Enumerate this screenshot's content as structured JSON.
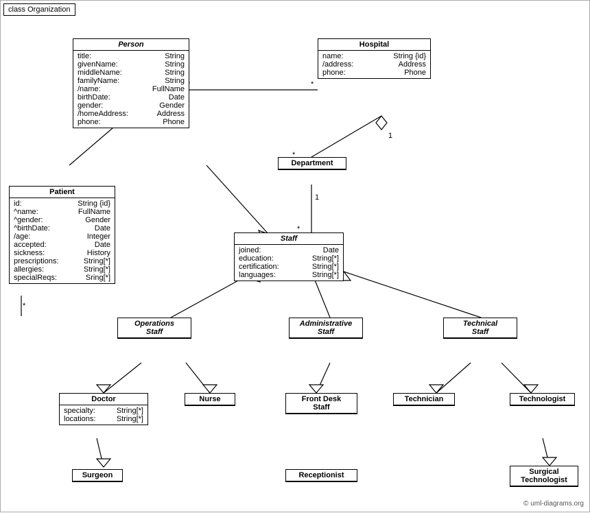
{
  "diagram": {
    "title": "class Organization",
    "copyright": "© uml-diagrams.org",
    "classes": {
      "person": {
        "name": "Person",
        "italic": true,
        "attrs": [
          {
            "name": "title:",
            "type": "String"
          },
          {
            "name": "givenName:",
            "type": "String"
          },
          {
            "name": "middleName:",
            "type": "String"
          },
          {
            "name": "familyName:",
            "type": "String"
          },
          {
            "name": "/name:",
            "type": "FullName"
          },
          {
            "name": "birthDate:",
            "type": "Date"
          },
          {
            "name": "gender:",
            "type": "Gender"
          },
          {
            "name": "/homeAddress:",
            "type": "Address"
          },
          {
            "name": "phone:",
            "type": "Phone"
          }
        ]
      },
      "hospital": {
        "name": "Hospital",
        "italic": false,
        "attrs": [
          {
            "name": "name:",
            "type": "String {id}"
          },
          {
            "name": "/address:",
            "type": "Address"
          },
          {
            "name": "phone:",
            "type": "Phone"
          }
        ]
      },
      "department": {
        "name": "Department",
        "italic": false,
        "attrs": []
      },
      "staff": {
        "name": "Staff",
        "italic": true,
        "attrs": [
          {
            "name": "joined:",
            "type": "Date"
          },
          {
            "name": "education:",
            "type": "String[*]"
          },
          {
            "name": "certification:",
            "type": "String[*]"
          },
          {
            "name": "languages:",
            "type": "String[*]"
          }
        ]
      },
      "patient": {
        "name": "Patient",
        "italic": false,
        "attrs": [
          {
            "name": "id:",
            "type": "String {id}"
          },
          {
            "name": "^name:",
            "type": "FullName"
          },
          {
            "name": "^gender:",
            "type": "Gender"
          },
          {
            "name": "^birthDate:",
            "type": "Date"
          },
          {
            "name": "/age:",
            "type": "Integer"
          },
          {
            "name": "accepted:",
            "type": "Date"
          },
          {
            "name": "sickness:",
            "type": "History"
          },
          {
            "name": "prescriptions:",
            "type": "String[*]"
          },
          {
            "name": "allergies:",
            "type": "String[*]"
          },
          {
            "name": "specialReqs:",
            "type": "Sring[*]"
          }
        ]
      },
      "operationsStaff": {
        "name": "Operations Staff",
        "italic": true
      },
      "administrativeStaff": {
        "name": "Administrative Staff",
        "italic": true
      },
      "technicalStaff": {
        "name": "Technical Staff",
        "italic": true
      },
      "doctor": {
        "name": "Doctor",
        "italic": false,
        "attrs": [
          {
            "name": "specialty:",
            "type": "String[*]"
          },
          {
            "name": "locations:",
            "type": "String[*]"
          }
        ]
      },
      "nurse": {
        "name": "Nurse",
        "italic": false,
        "attrs": []
      },
      "frontDeskStaff": {
        "name": "Front Desk Staff",
        "italic": false,
        "attrs": []
      },
      "technician": {
        "name": "Technician",
        "italic": false,
        "attrs": []
      },
      "technologist": {
        "name": "Technologist",
        "italic": false,
        "attrs": []
      },
      "surgeon": {
        "name": "Surgeon",
        "italic": false,
        "attrs": []
      },
      "receptionist": {
        "name": "Receptionist",
        "italic": false,
        "attrs": []
      },
      "surgicalTechnologist": {
        "name": "Surgical Technologist",
        "italic": false,
        "attrs": []
      }
    }
  }
}
